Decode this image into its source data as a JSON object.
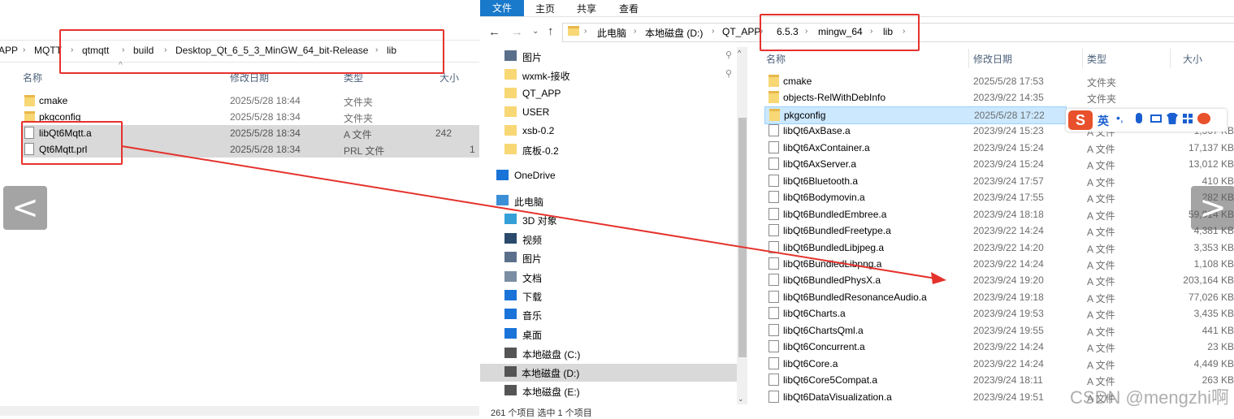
{
  "left_window": {
    "breadcrumb": [
      "APP",
      "MQTT",
      "qtmqtt",
      "build",
      "Desktop_Qt_6_5_3_MinGW_64_bit-Release",
      "lib"
    ],
    "columns": {
      "name": "名称",
      "date": "修改日期",
      "type": "类型",
      "size": "大小"
    },
    "rows": [
      {
        "name": "cmake",
        "date": "2025/5/28 18:44",
        "type": "文件夹",
        "size": "",
        "kind": "folder"
      },
      {
        "name": "pkgconfig",
        "date": "2025/5/28 18:34",
        "type": "文件夹",
        "size": "",
        "kind": "folder"
      },
      {
        "name": "libQt6Mqtt.a",
        "date": "2025/5/28 18:34",
        "type": "A 文件",
        "size": "242",
        "kind": "file"
      },
      {
        "name": "Qt6Mqtt.prl",
        "date": "2025/5/28 18:34",
        "type": "PRL 文件",
        "size": "1",
        "kind": "file"
      }
    ]
  },
  "right_window": {
    "ribbon_tabs": [
      "文件",
      "主页",
      "共享",
      "查看"
    ],
    "breadcrumb": [
      "此电脑",
      "本地磁盘 (D:)",
      "QT_APP",
      "6.5.3",
      "mingw_64",
      "lib"
    ],
    "nav": [
      {
        "label": "图片",
        "icon": "pictures-icon",
        "pinned": true
      },
      {
        "label": "wxmk-接收",
        "icon": "folder-icon",
        "pinned": true
      },
      {
        "label": "QT_APP",
        "icon": "folder-icon"
      },
      {
        "label": "USER",
        "icon": "folder-icon"
      },
      {
        "label": "xsb-0.2",
        "icon": "folder-icon"
      },
      {
        "label": "底板-0.2",
        "icon": "folder-icon"
      },
      {
        "label": "OneDrive",
        "icon": "cloud-icon"
      },
      {
        "label": "此电脑",
        "icon": "computer-icon"
      },
      {
        "label": "3D 对象",
        "icon": "3d-objects-icon"
      },
      {
        "label": "视频",
        "icon": "video-icon"
      },
      {
        "label": "图片",
        "icon": "pictures-icon"
      },
      {
        "label": "文档",
        "icon": "document-icon"
      },
      {
        "label": "下载",
        "icon": "download-icon"
      },
      {
        "label": "音乐",
        "icon": "music-icon"
      },
      {
        "label": "桌面",
        "icon": "desktop-icon"
      },
      {
        "label": "本地磁盘 (C:)",
        "icon": "drive-icon"
      },
      {
        "label": "本地磁盘 (D:)",
        "icon": "drive-icon",
        "selected": true
      },
      {
        "label": "本地磁盘 (E:)",
        "icon": "drive-icon"
      }
    ],
    "columns": {
      "name": "名称",
      "date": "修改日期",
      "type": "类型",
      "size": "大小"
    },
    "rows": [
      {
        "name": "cmake",
        "date": "2025/5/28 17:53",
        "type": "文件夹",
        "size": "",
        "kind": "folder"
      },
      {
        "name": "objects-RelWithDebInfo",
        "date": "2023/9/22 14:35",
        "type": "文件夹",
        "size": "",
        "kind": "folder"
      },
      {
        "name": "pkgconfig",
        "date": "2025/5/28 17:22",
        "type": "",
        "size": "",
        "kind": "folder",
        "highlight": true
      },
      {
        "name": "libQt6AxBase.a",
        "date": "2023/9/24 15:23",
        "type": "A 文件",
        "size": "1,567 KB",
        "kind": "file"
      },
      {
        "name": "libQt6AxContainer.a",
        "date": "2023/9/24 15:24",
        "type": "A 文件",
        "size": "17,137 KB",
        "kind": "file"
      },
      {
        "name": "libQt6AxServer.a",
        "date": "2023/9/24 15:24",
        "type": "A 文件",
        "size": "13,012 KB",
        "kind": "file"
      },
      {
        "name": "libQt6Bluetooth.a",
        "date": "2023/9/24 17:57",
        "type": "A 文件",
        "size": "410 KB",
        "kind": "file"
      },
      {
        "name": "libQt6Bodymovin.a",
        "date": "2023/9/24 17:55",
        "type": "A 文件",
        "size": "282 KB",
        "kind": "file"
      },
      {
        "name": "libQt6BundledEmbree.a",
        "date": "2023/9/24 18:18",
        "type": "A 文件",
        "size": "59,014 KB",
        "kind": "file"
      },
      {
        "name": "libQt6BundledFreetype.a",
        "date": "2023/9/22 14:24",
        "type": "A 文件",
        "size": "4,381 KB",
        "kind": "file"
      },
      {
        "name": "libQt6BundledLibjpeg.a",
        "date": "2023/9/22 14:20",
        "type": "A 文件",
        "size": "3,353 KB",
        "kind": "file"
      },
      {
        "name": "libQt6BundledLibpng.a",
        "date": "2023/9/22 14:24",
        "type": "A 文件",
        "size": "1,108 KB",
        "kind": "file"
      },
      {
        "name": "libQt6BundledPhysX.a",
        "date": "2023/9/24 19:20",
        "type": "A 文件",
        "size": "203,164 KB",
        "kind": "file"
      },
      {
        "name": "libQt6BundledResonanceAudio.a",
        "date": "2023/9/24 19:18",
        "type": "A 文件",
        "size": "77,026 KB",
        "kind": "file"
      },
      {
        "name": "libQt6Charts.a",
        "date": "2023/9/24 19:53",
        "type": "A 文件",
        "size": "3,435 KB",
        "kind": "file"
      },
      {
        "name": "libQt6ChartsQml.a",
        "date": "2023/9/24 19:55",
        "type": "A 文件",
        "size": "441 KB",
        "kind": "file"
      },
      {
        "name": "libQt6Concurrent.a",
        "date": "2023/9/22 14:24",
        "type": "A 文件",
        "size": "23 KB",
        "kind": "file"
      },
      {
        "name": "libQt6Core.a",
        "date": "2023/9/22 14:24",
        "type": "A 文件",
        "size": "4,449 KB",
        "kind": "file"
      },
      {
        "name": "libQt6Core5Compat.a",
        "date": "2023/9/24 18:11",
        "type": "A 文件",
        "size": "263 KB",
        "kind": "file"
      },
      {
        "name": "libQt6DataVisualization.a",
        "date": "2023/9/24 19:51",
        "type": "A 文件",
        "size": "",
        "kind": "file"
      }
    ],
    "status": "261 个项目    选中 1 个项目"
  },
  "ime_toolbar": {
    "label": "英"
  },
  "watermark": "CSDN @mengzhi啊",
  "colors": {
    "annotation_red": "#e5322d",
    "ribbon_blue": "#1979ca",
    "selection": "#cce8ff"
  }
}
